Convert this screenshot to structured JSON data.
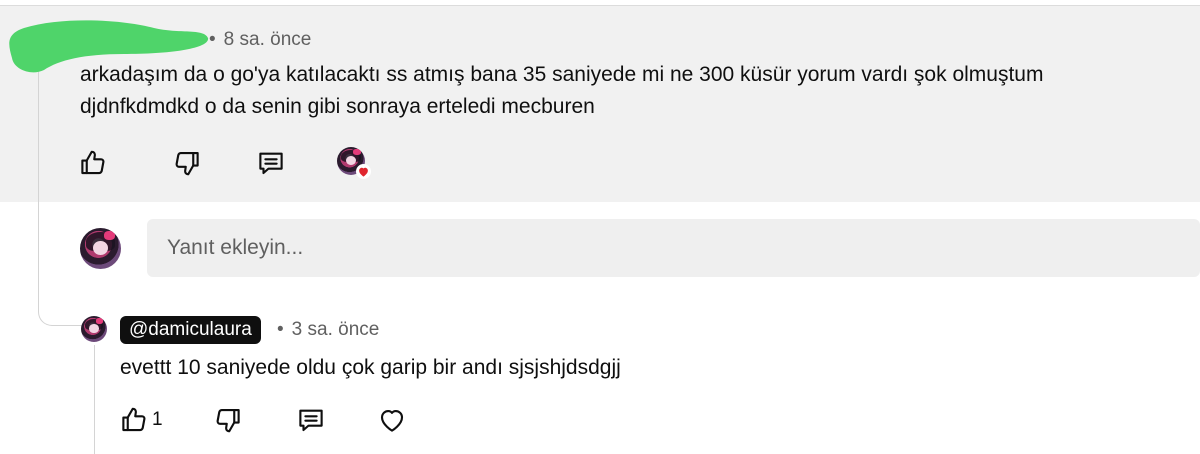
{
  "colors": {
    "card_background": "#f1f1f1",
    "redaction": "#4fd46a",
    "handle_chip": "#0f0f0f",
    "heart_badge": "#e0262f"
  },
  "comment": {
    "meta_separator": "•",
    "timestamp": "8 sa. önce",
    "text_line1": "arkadaşım da o go'ya katılacaktı ss atmış bana 35 saniyede mi ne 300 küsür yorum vardı şok olmuştum",
    "text_line2": "djdnfkdmdkd o da senin gibi sonraya erteledi mecburen",
    "actions": [
      "thumbs-up-icon",
      "thumbs-down-icon",
      "reply-icon",
      "creator-heart-icon"
    ]
  },
  "reply_box": {
    "placeholder": "Yanıt ekleyin..."
  },
  "reply": {
    "author_handle": "@damiculaura",
    "meta_separator": "•",
    "timestamp": "3 sa. önce",
    "text": "evettt 10 saniyede oldu çok garip bir andı sjsjshjdsdgjj",
    "like_count": "1",
    "actions": [
      "thumbs-up-icon",
      "thumbs-down-icon",
      "reply-icon",
      "heart-icon"
    ]
  }
}
